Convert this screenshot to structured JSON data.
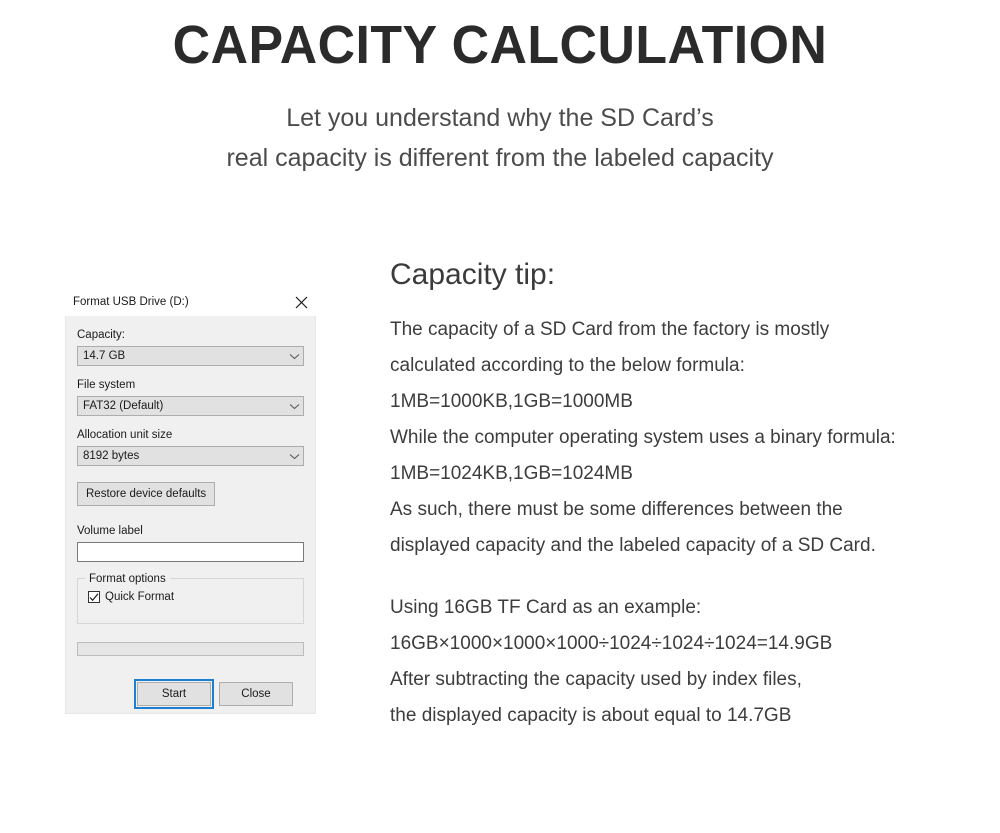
{
  "header": {
    "title": "CAPACITY CALCULATION",
    "subtitle_lines": [
      "Let you understand why the SD Card’s",
      "real capacity is different from the labeled capacity"
    ]
  },
  "dialog": {
    "title": "Format USB Drive (D:)",
    "close_icon": "close-icon",
    "capacity": {
      "label": "Capacity:",
      "value": "14.7 GB"
    },
    "file_system": {
      "label": "File system",
      "value": "FAT32 (Default)"
    },
    "allocation_unit": {
      "label": "Allocation unit size",
      "value": "8192 bytes"
    },
    "restore_button": "Restore device defaults",
    "volume_label": {
      "label": "Volume label",
      "value": "",
      "placeholder": ""
    },
    "format_options": {
      "title": "Format options",
      "quick_format": {
        "label": "Quick Format",
        "checked": true
      }
    },
    "progress": {
      "percent": 0
    },
    "start_button": "Start",
    "close_button": "Close",
    "accent_color": "#1d7fd0"
  },
  "tip": {
    "heading": "Capacity tip:",
    "paragraph_one": [
      "The capacity of a SD Card from the factory is mostly",
      "calculated according to the below formula:",
      "1MB=1000KB,1GB=1000MB",
      "While the computer operating system uses a binary formula:",
      "1MB=1024KB,1GB=1024MB",
      "As such, there must be some differences between the",
      "displayed capacity and the labeled capacity of a SD Card."
    ],
    "paragraph_two": [
      "Using 16GB TF Card as an example:",
      "16GB×1000×1000×1000÷1024÷1024÷1024=14.9GB",
      "After subtracting the capacity used by index files,",
      "the displayed capacity is about equal to 14.7GB"
    ]
  }
}
